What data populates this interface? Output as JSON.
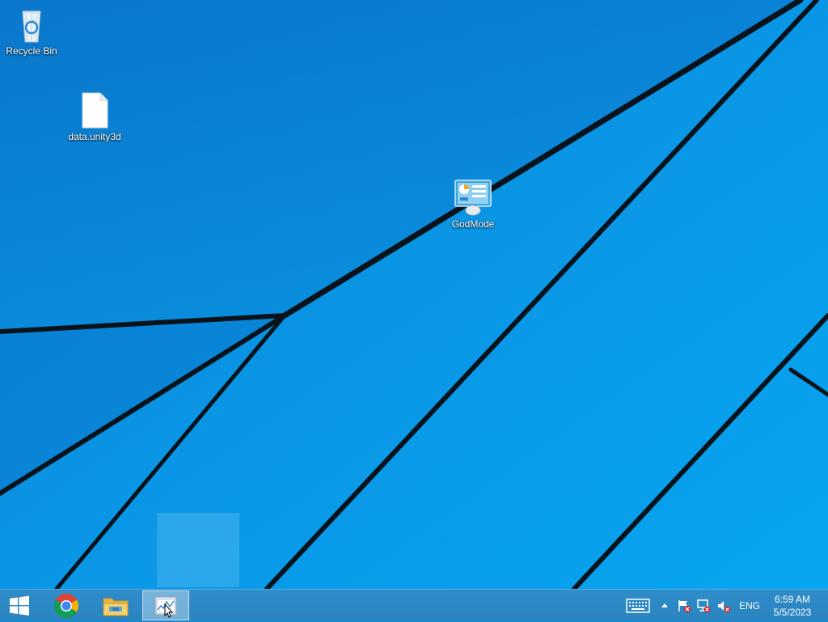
{
  "desktop": {
    "icons": [
      {
        "label": "Recycle Bin",
        "icon": "recycle-bin-icon"
      },
      {
        "label": "data.unity3d",
        "icon": "blank-file-icon"
      },
      {
        "label": "GodMode",
        "icon": "control-panel-icon"
      }
    ]
  },
  "taskbar": {
    "start": {
      "icon": "windows-logo-icon"
    },
    "pinned": [
      {
        "name": "Google Chrome",
        "icon": "chrome-icon"
      },
      {
        "name": "File Explorer",
        "icon": "folder-icon"
      },
      {
        "name": "Task Manager",
        "icon": "task-manager-icon",
        "active": true
      }
    ],
    "tray": {
      "keyboard": "touch-keyboard-icon",
      "show_hidden": "chevron-up-icon",
      "action_center": "flag-error-icon",
      "network": "network-error-icon",
      "volume": "volume-muted-icon",
      "language": "ENG"
    },
    "clock": {
      "time": "6:59 AM",
      "date": "5/5/2023"
    }
  },
  "colors": {
    "wallpaper": "#0a8fe0",
    "taskbar": "#2a84c0"
  }
}
